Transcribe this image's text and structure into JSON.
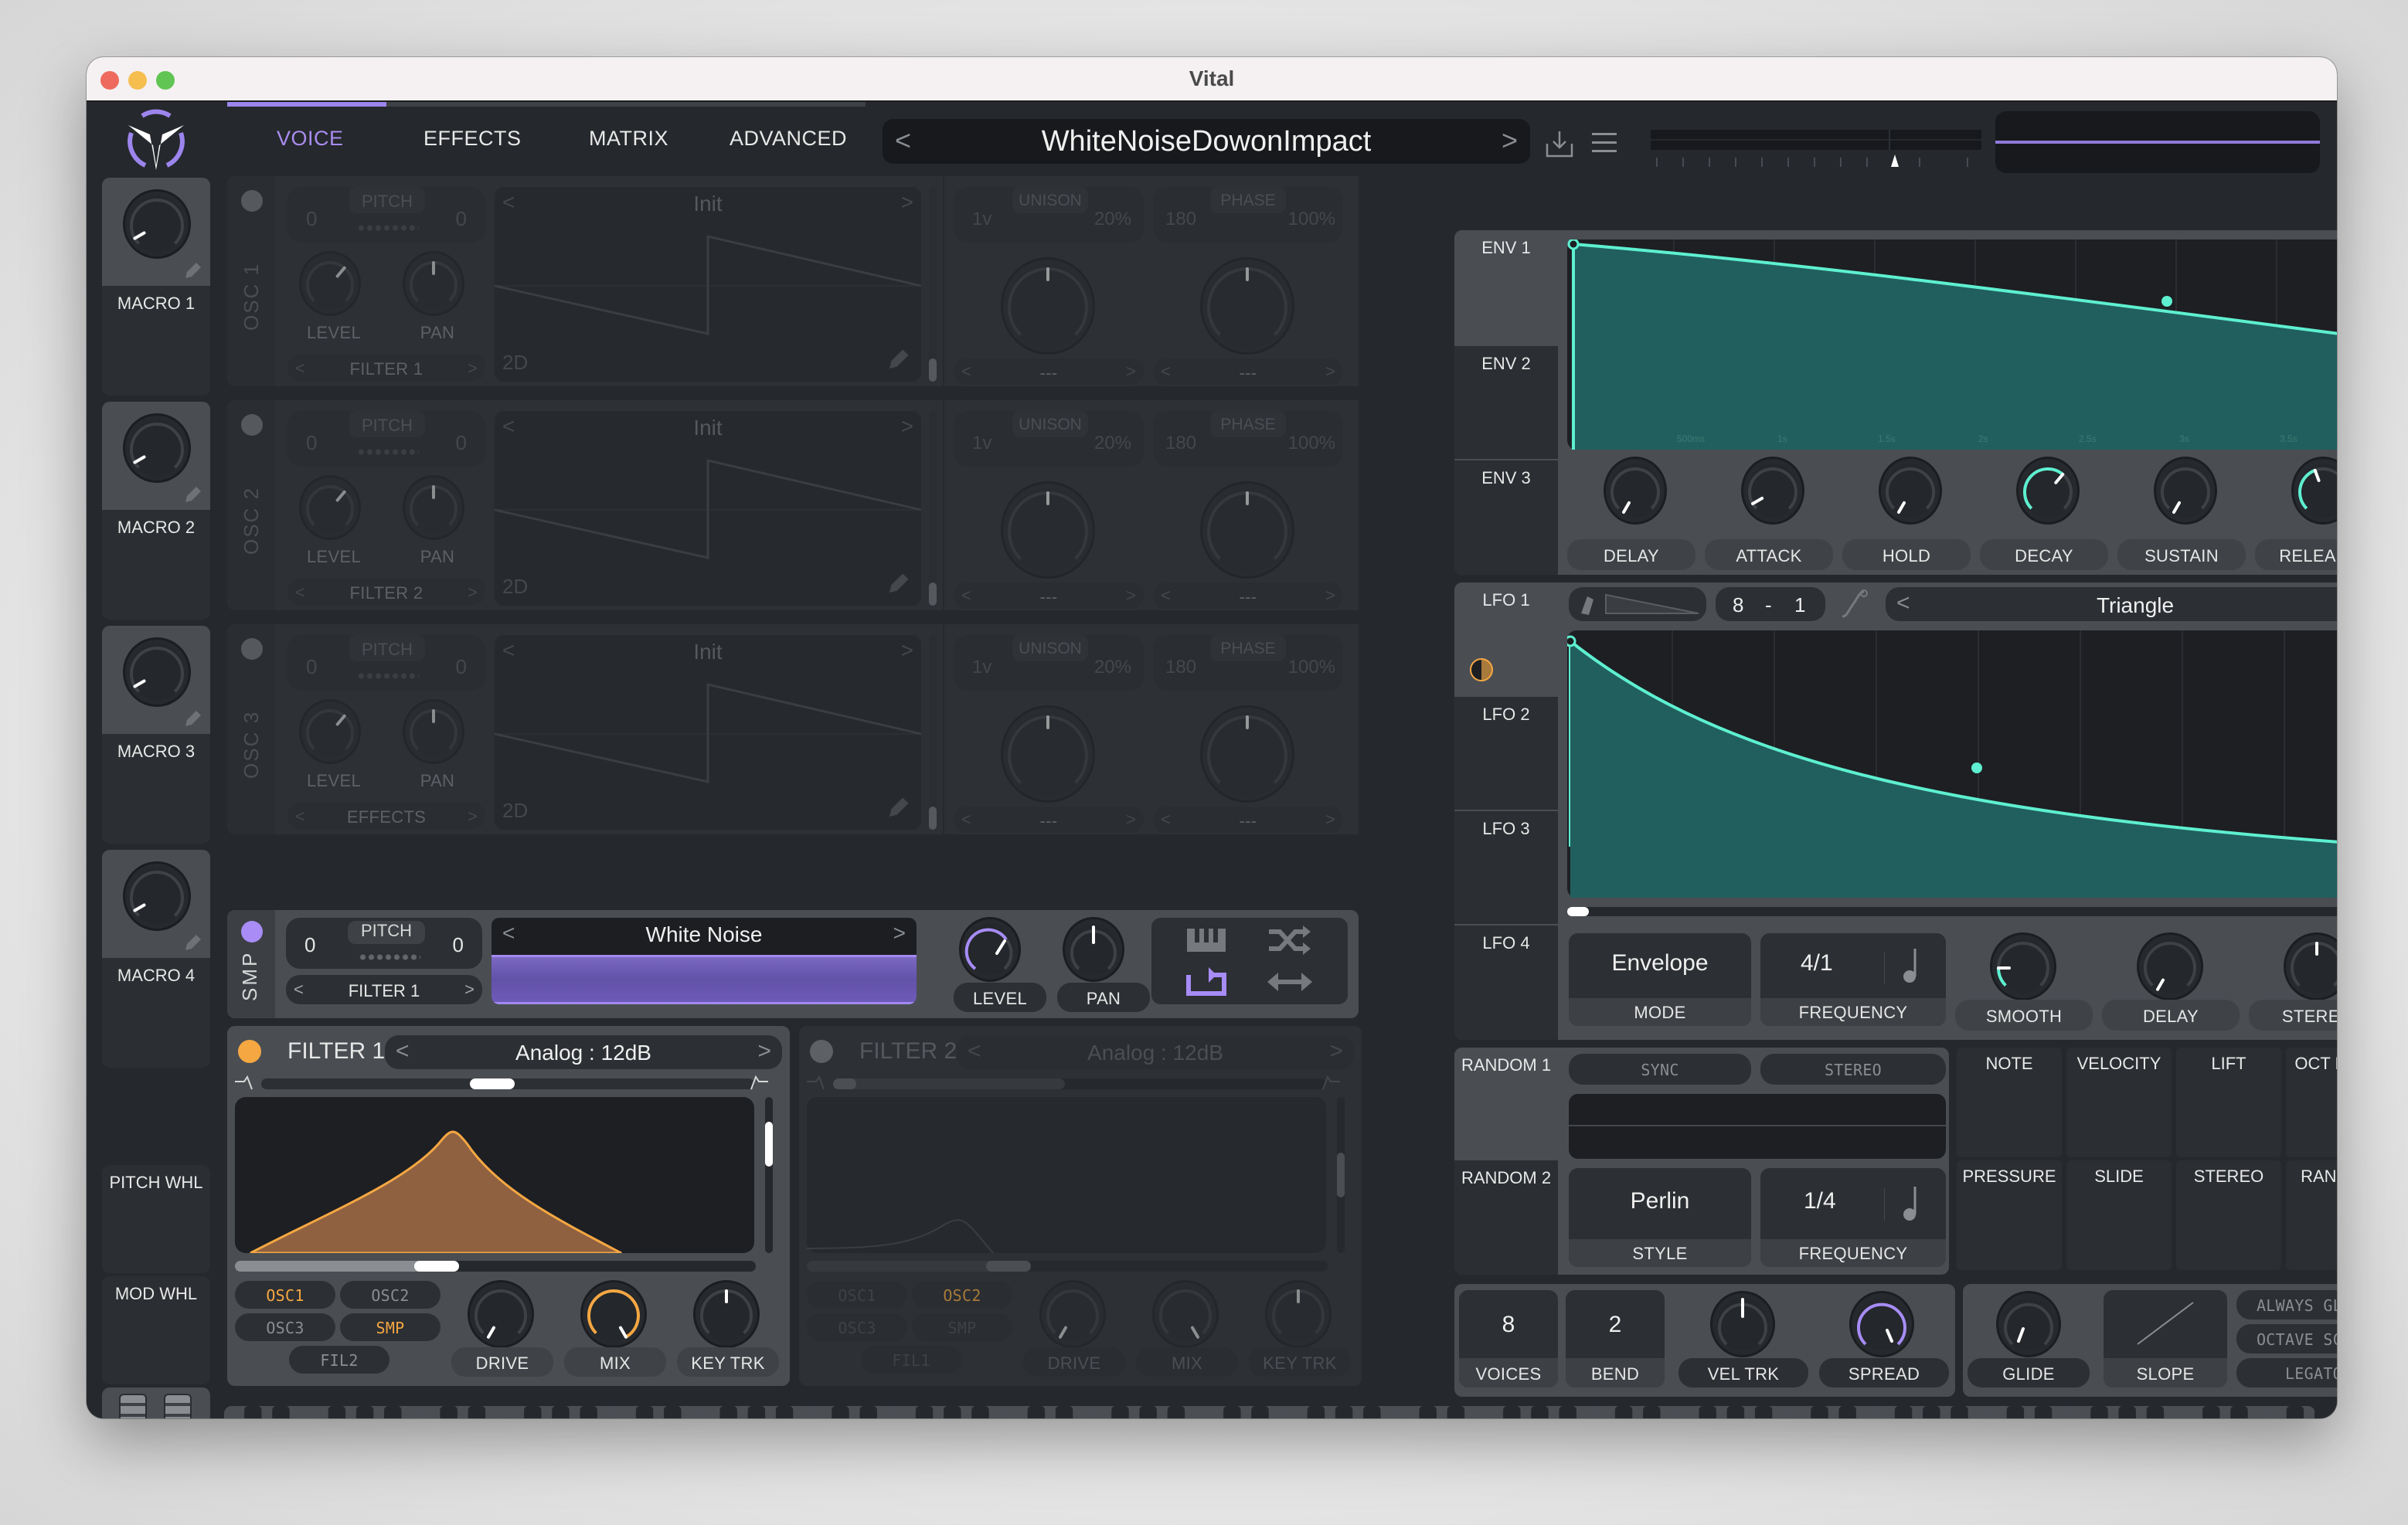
{
  "window": {
    "title": "Vital"
  },
  "header": {
    "tabs": [
      {
        "label": "VOICE",
        "active": true
      },
      {
        "label": "EFFECTS",
        "active": false
      },
      {
        "label": "MATRIX",
        "active": false
      },
      {
        "label": "ADVANCED",
        "active": false
      }
    ],
    "preset_name": "WhiteNoiseDowonImpact",
    "prev_preset": "<",
    "next_preset": ">",
    "save_icon": "save-icon",
    "menu_icon": "menu-icon"
  },
  "macros": [
    {
      "label": "MACRO 1",
      "value": 0.1
    },
    {
      "label": "MACRO 2",
      "value": 0.1
    },
    {
      "label": "MACRO 3",
      "value": 0.1
    },
    {
      "label": "MACRO 4",
      "value": 0.1
    }
  ],
  "wheels": {
    "pitch_label": "PITCH WHL",
    "mod_label": "MOD WHL"
  },
  "oscillators": [
    {
      "name": "OSC 1",
      "enabled": false,
      "pitch_label": "PITCH",
      "transpose": "0",
      "tune": "0",
      "level_label": "LEVEL",
      "pan_label": "PAN",
      "destination": "FILTER 1",
      "wavetable": "Init",
      "view_mode": "2D",
      "unison_label": "UNISON",
      "unison_voices": "1v",
      "unison_detune": "20%",
      "phase_label": "PHASE",
      "phase": "180",
      "phase_random": "100%",
      "unison_mode": "---",
      "phase_mode": "---"
    },
    {
      "name": "OSC 2",
      "enabled": false,
      "pitch_label": "PITCH",
      "transpose": "0",
      "tune": "0",
      "level_label": "LEVEL",
      "pan_label": "PAN",
      "destination": "FILTER 2",
      "wavetable": "Init",
      "view_mode": "2D",
      "unison_label": "UNISON",
      "unison_voices": "1v",
      "unison_detune": "20%",
      "phase_label": "PHASE",
      "phase": "180",
      "phase_random": "100%",
      "unison_mode": "---",
      "phase_mode": "---"
    },
    {
      "name": "OSC 3",
      "enabled": false,
      "pitch_label": "PITCH",
      "transpose": "0",
      "tune": "0",
      "level_label": "LEVEL",
      "pan_label": "PAN",
      "destination": "EFFECTS",
      "wavetable": "Init",
      "view_mode": "2D",
      "unison_label": "UNISON",
      "unison_voices": "1v",
      "unison_detune": "20%",
      "phase_label": "PHASE",
      "phase": "180",
      "phase_random": "100%",
      "unison_mode": "---",
      "phase_mode": "---"
    }
  ],
  "sample": {
    "name": "SMP",
    "enabled": true,
    "pitch_label": "PITCH",
    "transpose": "0",
    "tune": "0",
    "destination": "FILTER 1",
    "sample_name": "White Noise",
    "level_label": "LEVEL",
    "pan_label": "PAN"
  },
  "filters": [
    {
      "title": "FILTER 1",
      "enabled": true,
      "model": "Analog",
      "style": "12dB",
      "sep": ":",
      "sources": [
        {
          "label": "OSC1",
          "on": true
        },
        {
          "label": "OSC2",
          "on": false
        },
        {
          "label": "OSC3",
          "on": false
        },
        {
          "label": "SMP",
          "on": true
        }
      ],
      "other": "FIL2",
      "knobs": [
        "DRIVE",
        "MIX",
        "KEY TRK"
      ]
    },
    {
      "title": "FILTER 2",
      "enabled": false,
      "model": "Analog",
      "style": "12dB",
      "sep": ":",
      "sources": [
        {
          "label": "OSC1",
          "on": false
        },
        {
          "label": "OSC2",
          "on": true
        },
        {
          "label": "OSC3",
          "on": false
        },
        {
          "label": "SMP",
          "on": false
        }
      ],
      "other": "FIL1",
      "knobs": [
        "DRIVE",
        "MIX",
        "KEY TRK"
      ]
    }
  ],
  "envelopes": {
    "tabs": [
      "ENV 1",
      "ENV 2",
      "ENV 3"
    ],
    "time_labels": [
      "500ms",
      "1s",
      "1.5s",
      "2s",
      "2.5s",
      "3s",
      "3.5s"
    ],
    "knobs": [
      "DELAY",
      "ATTACK",
      "HOLD",
      "DECAY",
      "SUSTAIN",
      "RELEASE"
    ]
  },
  "lfos": {
    "tabs": [
      "LFO 1",
      "LFO 2",
      "LFO 3",
      "LFO 4"
    ],
    "grid_x": "8",
    "grid_sep": "-",
    "grid_y": "1",
    "shape": "Triangle",
    "mode_value": "Envelope",
    "mode_label": "MODE",
    "frequency_value": "4/1",
    "frequency_label": "FREQUENCY",
    "knobs": [
      "SMOOTH",
      "DELAY",
      "STEREO"
    ]
  },
  "random": {
    "tabs": [
      "RANDOM 1",
      "RANDOM 2"
    ],
    "sync_label": "SYNC",
    "stereo_label": "STEREO",
    "style_value": "Perlin",
    "style_label": "STYLE",
    "frequency_value": "1/4",
    "frequency_label": "FREQUENCY"
  },
  "mod_sources": [
    "NOTE",
    "VELOCITY",
    "LIFT",
    "OCT NOTE",
    "PRESSURE",
    "SLIDE",
    "STEREO",
    "RANDOM"
  ],
  "voice": {
    "voices_value": "8",
    "voices_label": "VOICES",
    "bend_value": "2",
    "bend_label": "BEND",
    "vel_trk_label": "VEL TRK",
    "spread_label": "SPREAD"
  },
  "glide": {
    "glide_label": "GLIDE",
    "slope_label": "SLOPE",
    "always_glide": "ALWAYS GLIDE",
    "octave_scale": "OCTAVE SCALE",
    "legato": "LEGATO"
  },
  "colors": {
    "accent": "#9d85ee",
    "filter": "#f5a742",
    "mod": "#5ef0d0",
    "panel": "#4a4e53",
    "bg": "#25282c"
  }
}
